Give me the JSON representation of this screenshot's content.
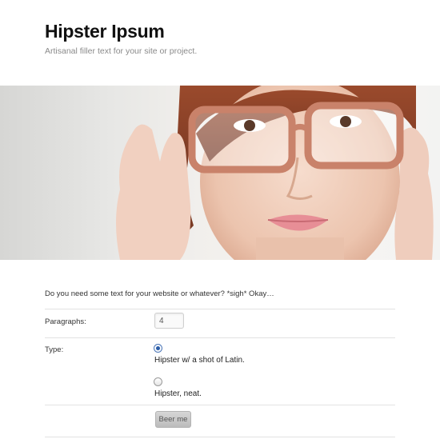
{
  "header": {
    "title": "Hipster Ipsum",
    "tagline": "Artisanal filler text for your site or project."
  },
  "hero": {
    "image_desc": "photo-of-woman-adjusting-glasses"
  },
  "form": {
    "intro": "Do you need some text for your website or whatever? *sigh* Okay…",
    "paragraphs_label": "Paragraphs:",
    "paragraphs_value": "4",
    "type_label": "Type:",
    "options": [
      {
        "label": "Hipster w/ a shot of Latin.",
        "checked": true
      },
      {
        "label": "Hipster, neat.",
        "checked": false
      }
    ],
    "submit_label": "Beer me"
  }
}
